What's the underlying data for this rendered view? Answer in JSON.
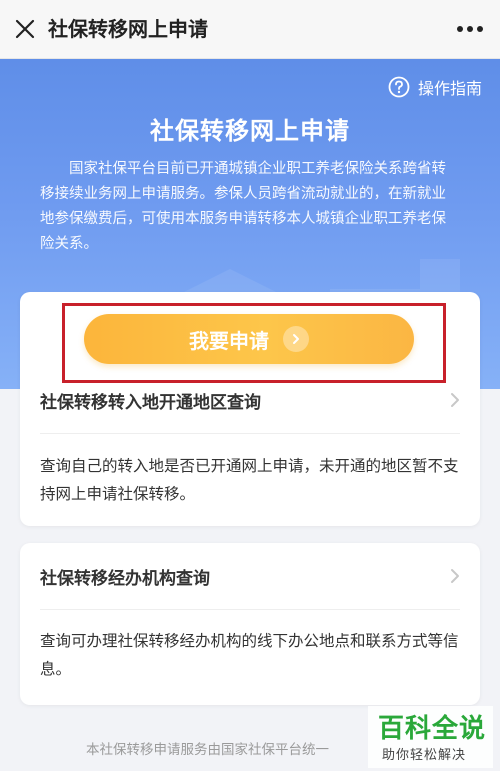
{
  "topbar": {
    "title": "社保转移网上申请",
    "close_icon": "close-icon",
    "more_icon": "more-dots-icon"
  },
  "hero": {
    "guide_label": "操作指南",
    "title": "社保转移网上申请",
    "description": "国家社保平台目前已开通城镇企业职工养老保险关系跨省转移接续业务网上申请服务。参保人员跨省流动就业的，在新就业地参保缴费后，可使用本服务申请转移本人城镇企业职工养老保险关系。",
    "colors": {
      "top": "#5f8ee8",
      "bottom": "#86b1f7"
    }
  },
  "card1": {
    "apply_label": "我要申请",
    "row_title": "社保转移转入地开通地区查询",
    "row_desc": "查询自己的转入地是否已开通网上申请，未开通的地区暂不支持网上申请社保转移。"
  },
  "card2": {
    "row_title": "社保转移经办机构查询",
    "row_desc": "查询可办理社保转移经办机构的线下办公地点和联系方式等信息。"
  },
  "footer": {
    "text": "本社保转移申请服务由国家社保平台统一"
  },
  "watermark": {
    "title": "百科全说",
    "subtitle": "助你轻松解决"
  },
  "accent": {
    "button": "#fdc64a",
    "highlight": "#c8202a",
    "brand_green": "#2aa83a"
  }
}
